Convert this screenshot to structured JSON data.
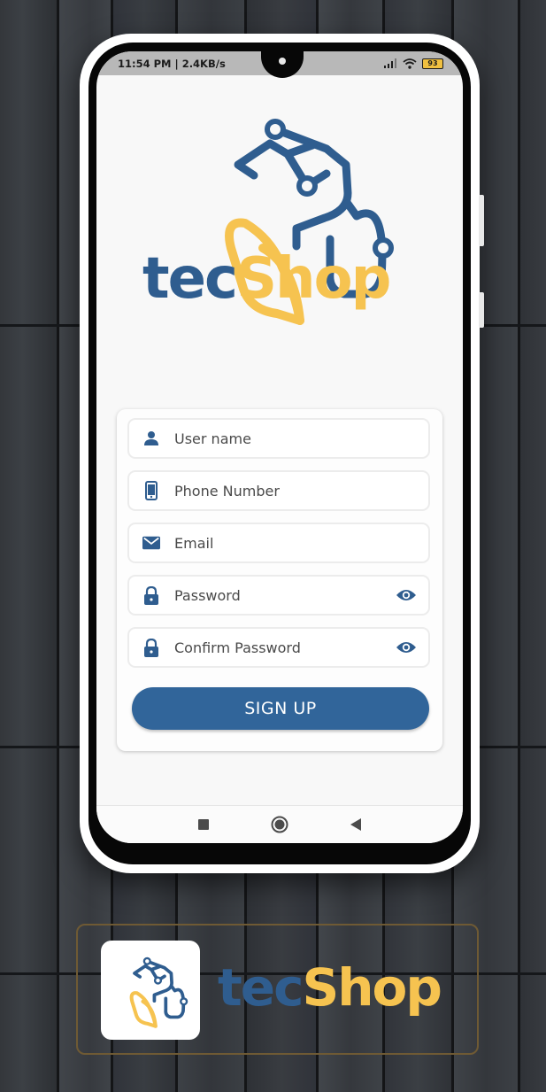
{
  "status_bar": {
    "time_speed": "11:54 PM | 2.4KB/s",
    "battery": "93"
  },
  "brand": {
    "name_part1": "tec",
    "name_part2": "Shop",
    "colors": {
      "blue": "#2f5d8f",
      "yellow": "#f6c350"
    }
  },
  "form": {
    "fields": [
      {
        "placeholder": "User name",
        "icon": "person-icon"
      },
      {
        "placeholder": "Phone Number",
        "icon": "phone-icon"
      },
      {
        "placeholder": "Email",
        "icon": "mail-icon"
      },
      {
        "placeholder": "Password",
        "icon": "lock-icon",
        "trailing_icon": "eye-icon"
      },
      {
        "placeholder": "Confirm Password",
        "icon": "lock-icon",
        "trailing_icon": "eye-icon"
      }
    ],
    "submit_label": "SIGN UP",
    "accent_color": "#31659a"
  },
  "nav_bar": {
    "buttons": [
      "recents-square-icon",
      "home-circle-icon",
      "back-triangle-icon"
    ]
  }
}
